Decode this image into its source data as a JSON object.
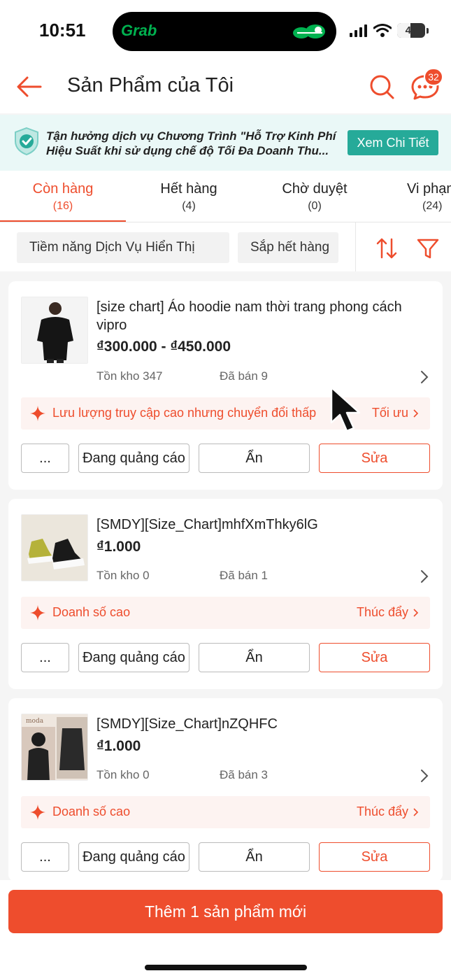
{
  "status_bar": {
    "time": "10:51",
    "island_app": "Grab",
    "battery": "47"
  },
  "header": {
    "title": "Sản Phẩm của Tôi",
    "chat_badge": "32"
  },
  "banner": {
    "line1": "Tận hưởng dịch vụ Chương Trình \"Hỗ Trợ Kinh Phí",
    "line2": "Hiệu Suất khi sử dụng chế độ Tối Đa Doanh Thu...",
    "button": "Xem Chi Tiết"
  },
  "tabs": [
    {
      "label": "Còn hàng",
      "count": "(16)"
    },
    {
      "label": "Hết hàng",
      "count": "(4)"
    },
    {
      "label": "Chờ duyệt",
      "count": "(0)"
    },
    {
      "label": "Vi phạm",
      "count": "(24)"
    }
  ],
  "filters": {
    "chip1": "Tiềm năng Dịch Vụ Hiển Thị",
    "chip2": "Sắp hết hàng"
  },
  "products": [
    {
      "name": "[size chart] Áo hoodie nam thời trang phong cách vipro",
      "price": "₫300.000 - ₫450.000",
      "stock": "Tồn kho 347",
      "sold": "Đã bán 9",
      "insight": "Lưu lượng truy cập cao nhưng chuyển đổi thấp",
      "insight_action": "Tối ưu"
    },
    {
      "name": "[SMDY][Size_Chart]mhfXmThky6lG",
      "price": "₫1.000",
      "stock": "Tồn kho 0",
      "sold": "Đã bán 1",
      "insight": "Doanh số cao",
      "insight_action": "Thúc đẩy"
    },
    {
      "name": "[SMDY][Size_Chart]nZQHFC",
      "price": "₫1.000",
      "stock": "Tồn kho 0",
      "sold": "Đã bán 3",
      "insight": "Doanh số cao",
      "insight_action": "Thúc đẩy"
    }
  ],
  "actions": {
    "more": "...",
    "ads": "Đang quảng cáo",
    "hide": "Ẩn",
    "edit": "Sửa"
  },
  "bottom": {
    "add_button": "Thêm 1 sản phẩm mới"
  },
  "colors": {
    "accent": "#ee4d2d",
    "teal": "#26aa99",
    "banner_bg": "#eaf8f7"
  }
}
